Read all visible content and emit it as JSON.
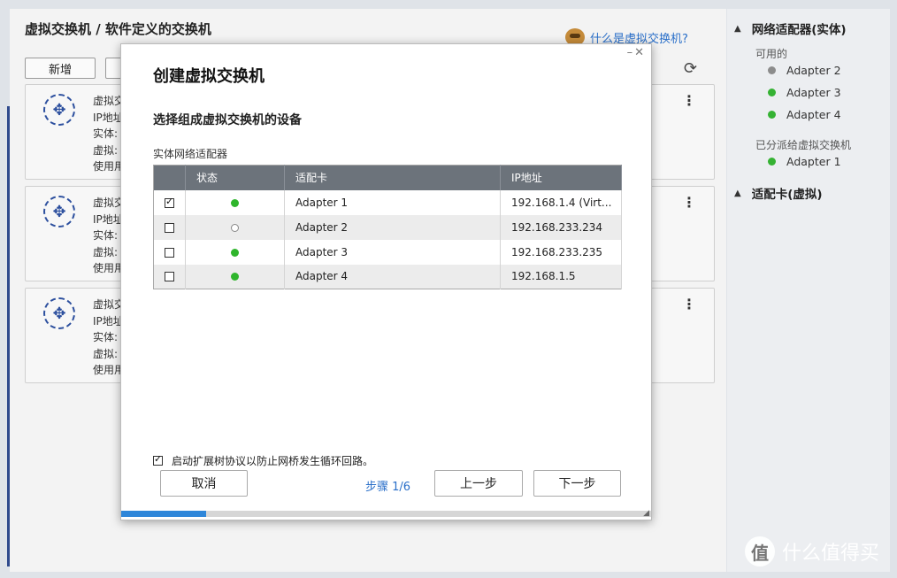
{
  "main": {
    "title": "虚拟交换机 / 软件定义的交换机",
    "help_link": "什么是虚拟交换机?",
    "new_button": "新增",
    "cards": [
      {
        "lines": [
          "虚拟交",
          "IP地址",
          "实体:",
          "虚拟:",
          "使用用"
        ]
      },
      {
        "lines": [
          "虚拟交",
          "IP地址",
          "实体:",
          "虚拟:",
          "使用用"
        ]
      },
      {
        "lines": [
          "虚拟交",
          "IP地址",
          "实体:",
          "虚拟:",
          "使用用"
        ]
      }
    ]
  },
  "right_panel": {
    "physical_header": "网络适配器(实体)",
    "available_label": "可用的",
    "available": [
      {
        "name": "Adapter 2",
        "status": "gray"
      },
      {
        "name": "Adapter 3",
        "status": "green"
      },
      {
        "name": "Adapter 4",
        "status": "green"
      }
    ],
    "assigned_label": "已分派给虚拟交换机",
    "assigned": [
      {
        "name": "Adapter 1",
        "status": "green"
      }
    ],
    "virtual_header": "适配卡(虚拟)",
    "watermark": "什么值得买",
    "watermark_glyph": "值"
  },
  "modal": {
    "title": "创建虚拟交换机",
    "subtitle": "选择组成虚拟交换机的设备",
    "table_label": "实体网络适配器",
    "columns": {
      "status": "状态",
      "adapter": "适配卡",
      "ip": "IP地址"
    },
    "rows": [
      {
        "checked": true,
        "status": "on",
        "adapter": "Adapter 1",
        "ip": "192.168.1.4 (Virt..."
      },
      {
        "checked": false,
        "status": "off",
        "adapter": "Adapter 2",
        "ip": "192.168.233.234"
      },
      {
        "checked": false,
        "status": "on",
        "adapter": "Adapter 3",
        "ip": "192.168.233.235"
      },
      {
        "checked": false,
        "status": "on",
        "adapter": "Adapter 4",
        "ip": "192.168.1.5"
      }
    ],
    "stp_label": "启动扩展树协议以防止网桥发生循环回路。",
    "stp_checked": true,
    "cancel": "取消",
    "step": "步骤 1/6",
    "prev": "上一步",
    "next": "下一步",
    "progress_fraction": 0.16
  },
  "colors": {
    "accent": "#2e86d9",
    "link": "#2a6fc9",
    "status_green": "#35b233",
    "status_gray": "#8c8c8c",
    "header_bg": "#6c737b"
  }
}
